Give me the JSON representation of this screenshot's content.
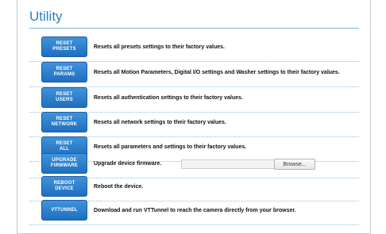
{
  "section": {
    "title": "Utility"
  },
  "rows": [
    {
      "button": [
        "RESET",
        "PRESETS"
      ],
      "description": "Resets all presets settings to their factory values."
    },
    {
      "button": [
        "RESET",
        "PARAMS"
      ],
      "description": "Resets all Motion Parameters, Digital I/O settings and Washer settings to their factory values."
    },
    {
      "button": [
        "RESET",
        "USERS"
      ],
      "description": "Resets all authentication settings to their factory values."
    },
    {
      "button": [
        "RESET",
        "NETWORK"
      ],
      "description": "Resets all network settings to their factory values."
    },
    {
      "button": [
        "RESET",
        "ALL"
      ],
      "description": "Resets all parameters and settings to their factory values."
    },
    {
      "button": [
        "UPGRADE",
        "FIRMWARE"
      ],
      "description": "Upgrade device firmware.",
      "browse_label": "Browse...",
      "file_value": ""
    },
    {
      "button": [
        "REBOOT",
        "DEVICE"
      ],
      "description": "Reboot the device."
    },
    {
      "button": [
        "VTTUNNEL"
      ],
      "description": "Download and run VTTunnel to reach the camera directly from your browser."
    }
  ]
}
